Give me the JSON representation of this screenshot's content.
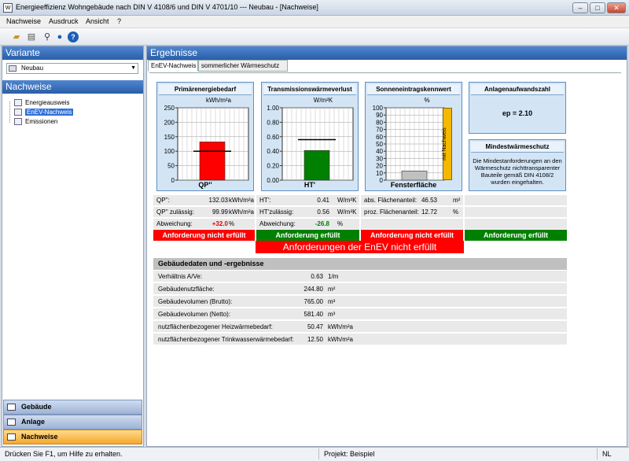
{
  "window": {
    "title": "Energieeffizienz Wohngebäude nach DIN V 4108/6 und DIN V 4701/10 --- Neubau - [Nachweise]",
    "icon": "app-icon",
    "buttons": [
      "minimize-icon",
      "maximize-icon",
      "close-icon"
    ]
  },
  "menubar": [
    "Nachweise",
    "Ausdruck",
    "Ansicht",
    "?"
  ],
  "toolbar": [
    "open-icon",
    "print-icon",
    "preview-icon",
    "globe-icon",
    "help-icon"
  ],
  "left": {
    "variante_title": "Variante",
    "variant_value": "Neubau",
    "nachweise_title": "Nachweise",
    "tree": [
      "Energieausweis",
      "EnEV-Nachweis",
      "Emissionen"
    ],
    "tree_selected": "EnEV-Nachweis",
    "nav": [
      "Gebäude",
      "Anlage",
      "Nachweise"
    ],
    "nav_active": "Nachweise"
  },
  "right": {
    "title": "Ergebnisse",
    "tabs": [
      "EnEV-Nachweis",
      "sommerlicher Wärmeschutz"
    ],
    "active_tab": "EnEV-Nachweis"
  },
  "cards": {
    "qp": {
      "title": "Primärenergiebedarf",
      "unit": "kWh/m²a",
      "label": "QP''"
    },
    "ht": {
      "title": "Transmissionswärmeverlust",
      "unit": "W/m²K",
      "label": "HT'"
    },
    "sonne": {
      "title": "Sonneneintragskennwert",
      "unit": "%",
      "label": "Fensterfläche",
      "side_label": "mit Nachweis"
    },
    "anlage": {
      "title": "Anlagenaufwandszahl",
      "value": "ep = 2.10"
    },
    "mind": {
      "title": "Mindestwärmeschutz",
      "text": "Die Mindestanforderungen an den Wärmeschutz nichttransparenter Bauteile gemäß DIN 4108/2 wurden eingehalten."
    }
  },
  "chart_data": [
    {
      "type": "bar",
      "title": "Primärenergiebedarf",
      "ylabel": "kWh/m²a",
      "ylim": [
        0,
        250
      ],
      "yticks": [
        "0",
        "50",
        "100",
        "150",
        "200",
        "250"
      ],
      "categories": [
        "QP''"
      ],
      "values": [
        132.03
      ],
      "limit": 99.99,
      "colors": {
        "bar": "#ff0000"
      }
    },
    {
      "type": "bar",
      "title": "Transmissionswärmeverlust",
      "ylabel": "W/m²K",
      "ylim": [
        0,
        1.0
      ],
      "yticks": [
        "0.00",
        "0.20",
        "0.40",
        "0.60",
        "0.80",
        "1.00"
      ],
      "categories": [
        "HT'"
      ],
      "values": [
        0.41
      ],
      "limit": 0.56,
      "colors": {
        "bar": "#008000"
      }
    },
    {
      "type": "bar",
      "title": "Sonneneintragskennwert",
      "ylabel": "%",
      "ylim": [
        0,
        100
      ],
      "yticks": [
        "0",
        "10",
        "20",
        "30",
        "40",
        "50",
        "60",
        "70",
        "80",
        "90",
        "100"
      ],
      "categories": [
        "Fensterfläche"
      ],
      "values": [
        12.72
      ],
      "colors": {
        "bar": "#c0c0c0",
        "side": "#f5b800"
      }
    }
  ],
  "values": {
    "qp": [
      {
        "label": "QP'':",
        "value": "132.03",
        "unit": "kWh/m²a"
      },
      {
        "label": "QP'' zulässig:",
        "value": "99.99",
        "unit": "kWh/m²a"
      },
      {
        "label": "Abweichung:",
        "value": "+32.0",
        "unit": "%"
      }
    ],
    "ht": [
      {
        "label": "HT':",
        "value": "0.41",
        "unit": "W/m²K"
      },
      {
        "label": "HT'zulässig:",
        "value": "0.56",
        "unit": "W/m²K"
      },
      {
        "label": "Abweichung:",
        "value": "-26.8",
        "unit": "%"
      }
    ],
    "sonne": [
      {
        "label": "abs. Flächenanteil:",
        "value": "46.53",
        "unit": "m²"
      },
      {
        "label": "proz. Flächenanteil:",
        "value": "12.72",
        "unit": "%"
      }
    ]
  },
  "status": {
    "qp": "Anforderung nicht erfüllt",
    "ht": "Anforderung erfüllt",
    "sonne": "Anforderung nicht erfüllt",
    "mind": "Anforderung erfüllt",
    "overall": "Anforderungen der EnEV nicht erfüllt",
    "colors": {
      "fail": "#ff0000",
      "pass": "#008000"
    }
  },
  "building": {
    "title": "Gebäudedaten und -ergebnisse",
    "rows": [
      {
        "label": "Verhältnis A/Ve:",
        "value": "0.63",
        "unit": "1/m"
      },
      {
        "label": "Gebäudenutzfläche:",
        "value": "244.80",
        "unit": "m²"
      },
      {
        "label": "Gebäudevolumen (Brutto):",
        "value": "765.00",
        "unit": "m³"
      },
      {
        "label": "Gebäudevolumen (Netto):",
        "value": "581.40",
        "unit": "m³"
      },
      {
        "label": "nutzflächenbezogener Heizwärmebedarf:",
        "value": "50.47",
        "unit": "kWh/m²a"
      },
      {
        "label": "nutzflächenbezogener Trinkwasserwärmebedarf:",
        "value": "12.50",
        "unit": "kWh/m²a"
      }
    ]
  },
  "statusbar": {
    "help": "Drücken Sie F1, um Hilfe zu erhalten.",
    "project": "Projekt: Beispiel",
    "mode": "NL"
  }
}
